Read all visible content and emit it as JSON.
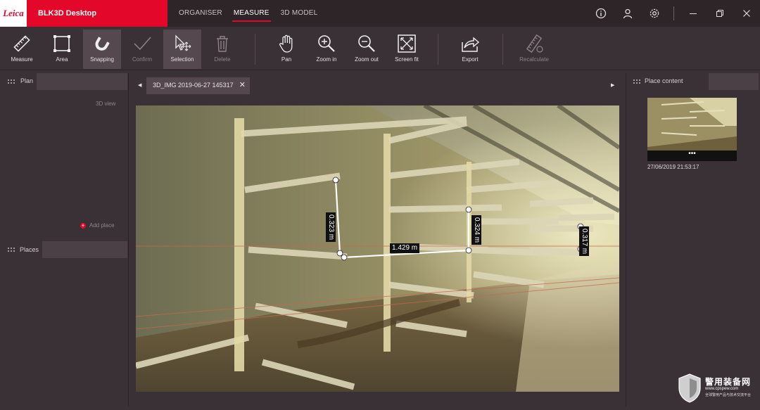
{
  "app": {
    "logo_text": "Leica",
    "name": "BLK3D Desktop"
  },
  "nav": {
    "tabs": [
      {
        "label": "ORGANISER"
      },
      {
        "label": "MEASURE"
      },
      {
        "label": "3D MODEL"
      }
    ],
    "active": "MEASURE"
  },
  "toolbar": {
    "measure": "Measure",
    "area": "Area",
    "snapping": "Snapping",
    "confirm": "Confirm",
    "selection": "Selection",
    "delete": "Delete",
    "pan": "Pan",
    "zoom_in": "Zoom in",
    "zoom_out": "Zoom out",
    "screen_fit": "Screen fit",
    "export": "Export",
    "recalculate": "Recalculate"
  },
  "left": {
    "plan_title": "Plan",
    "view_label": "3D view",
    "add_place": "Add place",
    "places_title": "Places"
  },
  "center": {
    "file_tab": "3D_IMG 2019-06-27 145317"
  },
  "measurements": {
    "m1": "0.323 m",
    "m2": "1.429 m",
    "m3": "0.324 m",
    "m4": "0.317 m"
  },
  "right": {
    "title": "Place content",
    "thumb_more": "•••",
    "date": "27/06/2019 21:53:17"
  },
  "watermark": {
    "title": "警用装备网",
    "url": "www.cpspew.com",
    "subtitle": "全球警用产品与技术交流平台"
  },
  "colors": {
    "accent": "#e3072a",
    "panel": "#3a3136"
  }
}
